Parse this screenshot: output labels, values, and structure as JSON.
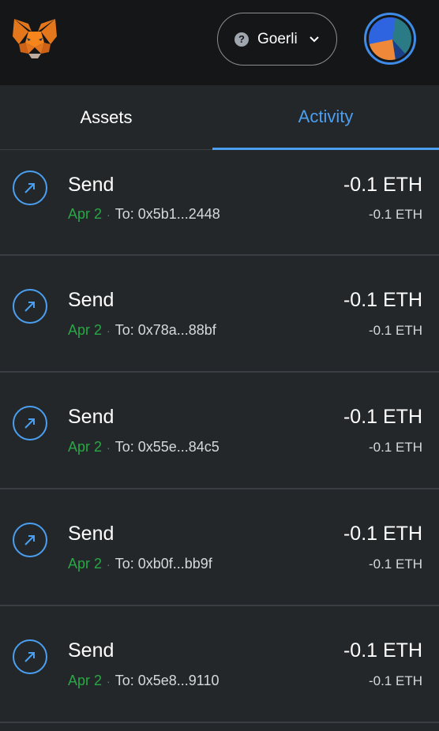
{
  "header": {
    "network": {
      "name": "Goerli",
      "status_icon": "question-icon"
    }
  },
  "tabs": [
    {
      "label": "Assets",
      "active": false
    },
    {
      "label": "Activity",
      "active": true
    }
  ],
  "activity": [
    {
      "title": "Send",
      "date": "Apr 2",
      "to": "To: 0x5b1...2448",
      "amount": "-0.1 ETH",
      "fiat": "-0.1 ETH"
    },
    {
      "title": "Send",
      "date": "Apr 2",
      "to": "To: 0x78a...88bf",
      "amount": "-0.1 ETH",
      "fiat": "-0.1 ETH"
    },
    {
      "title": "Send",
      "date": "Apr 2",
      "to": "To: 0x55e...84c5",
      "amount": "-0.1 ETH",
      "fiat": "-0.1 ETH"
    },
    {
      "title": "Send",
      "date": "Apr 2",
      "to": "To: 0xb0f...bb9f",
      "amount": "-0.1 ETH",
      "fiat": "-0.1 ETH"
    },
    {
      "title": "Send",
      "date": "Apr 2",
      "to": "To: 0x5e8...9110",
      "amount": "-0.1 ETH",
      "fiat": "-0.1 ETH"
    }
  ],
  "colors": {
    "accent": "#4a9ff0",
    "date_green": "#28a745",
    "background": "#24272a",
    "header_bg": "#141618"
  }
}
